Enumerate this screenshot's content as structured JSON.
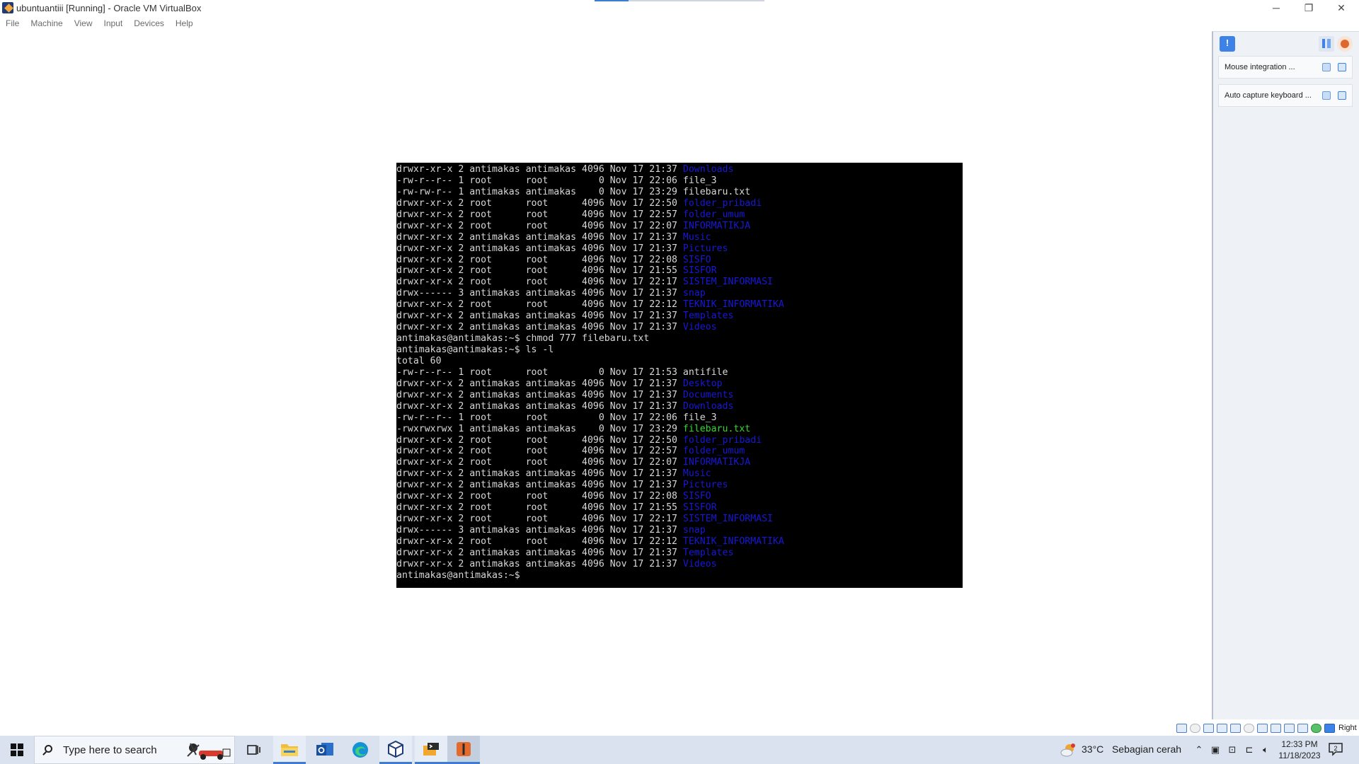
{
  "window": {
    "title": "ubuntuantiii [Running] - Oracle VM VirtualBox",
    "minimize": "─",
    "restore": "❐",
    "close": "✕"
  },
  "menu": [
    "File",
    "Machine",
    "View",
    "Input",
    "Devices",
    "Help"
  ],
  "terminal": {
    "lines": [
      [
        {
          "t": "drwxr-xr-x 2 antimakas antimakas 4096 Nov 17 21:37 ",
          "c": ""
        },
        {
          "t": "Downloads",
          "c": "dir"
        }
      ],
      [
        {
          "t": "-rw-r--r-- 1 root      root         0 Nov 17 22:06 file_3",
          "c": ""
        }
      ],
      [
        {
          "t": "-rw-rw-r-- 1 antimakas antimakas    0 Nov 17 23:29 filebaru.txt",
          "c": ""
        }
      ],
      [
        {
          "t": "drwxr-xr-x 2 root      root      4096 Nov 17 22:50 ",
          "c": ""
        },
        {
          "t": "folder_pribadi",
          "c": "dir"
        }
      ],
      [
        {
          "t": "drwxr-xr-x 2 root      root      4096 Nov 17 22:57 ",
          "c": ""
        },
        {
          "t": "folder_umum",
          "c": "dir"
        }
      ],
      [
        {
          "t": "drwxr-xr-x 2 root      root      4096 Nov 17 22:07 ",
          "c": ""
        },
        {
          "t": "INFORMATIKJA",
          "c": "dir"
        }
      ],
      [
        {
          "t": "drwxr-xr-x 2 antimakas antimakas 4096 Nov 17 21:37 ",
          "c": ""
        },
        {
          "t": "Music",
          "c": "dir"
        }
      ],
      [
        {
          "t": "drwxr-xr-x 2 antimakas antimakas 4096 Nov 17 21:37 ",
          "c": ""
        },
        {
          "t": "Pictures",
          "c": "dir"
        }
      ],
      [
        {
          "t": "drwxr-xr-x 2 root      root      4096 Nov 17 22:08 ",
          "c": ""
        },
        {
          "t": "SISFO",
          "c": "dir"
        }
      ],
      [
        {
          "t": "drwxr-xr-x 2 root      root      4096 Nov 17 21:55 ",
          "c": ""
        },
        {
          "t": "SISFOR",
          "c": "dir"
        }
      ],
      [
        {
          "t": "drwxr-xr-x 2 root      root      4096 Nov 17 22:17 ",
          "c": ""
        },
        {
          "t": "SISTEM_INFORMASI",
          "c": "dir"
        }
      ],
      [
        {
          "t": "drwx------ 3 antimakas antimakas 4096 Nov 17 21:37 ",
          "c": ""
        },
        {
          "t": "snap",
          "c": "dir"
        }
      ],
      [
        {
          "t": "drwxr-xr-x 2 root      root      4096 Nov 17 22:12 ",
          "c": ""
        },
        {
          "t": "TEKNIK_INFORMATIKA",
          "c": "dir"
        }
      ],
      [
        {
          "t": "drwxr-xr-x 2 antimakas antimakas 4096 Nov 17 21:37 ",
          "c": ""
        },
        {
          "t": "Templates",
          "c": "dir"
        }
      ],
      [
        {
          "t": "drwxr-xr-x 2 antimakas antimakas 4096 Nov 17 21:37 ",
          "c": ""
        },
        {
          "t": "Videos",
          "c": "dir"
        }
      ],
      [
        {
          "t": "antimakas@antimakas:~$ chmod 777 filebaru.txt",
          "c": ""
        }
      ],
      [
        {
          "t": "antimakas@antimakas:~$ ls -l",
          "c": ""
        }
      ],
      [
        {
          "t": "total 60",
          "c": ""
        }
      ],
      [
        {
          "t": "-rw-r--r-- 1 root      root         0 Nov 17 21:53 antifile",
          "c": ""
        }
      ],
      [
        {
          "t": "drwxr-xr-x 2 antimakas antimakas 4096 Nov 17 21:37 ",
          "c": ""
        },
        {
          "t": "Desktop",
          "c": "dir"
        }
      ],
      [
        {
          "t": "drwxr-xr-x 2 antimakas antimakas 4096 Nov 17 21:37 ",
          "c": ""
        },
        {
          "t": "Documents",
          "c": "dir"
        }
      ],
      [
        {
          "t": "drwxr-xr-x 2 antimakas antimakas 4096 Nov 17 21:37 ",
          "c": ""
        },
        {
          "t": "Downloads",
          "c": "dir"
        }
      ],
      [
        {
          "t": "-rw-r--r-- 1 root      root         0 Nov 17 22:06 file_3",
          "c": ""
        }
      ],
      [
        {
          "t": "-rwxrwxrwx 1 antimakas antimakas    0 Nov 17 23:29 ",
          "c": ""
        },
        {
          "t": "filebaru.txt",
          "c": "exe"
        }
      ],
      [
        {
          "t": "drwxr-xr-x 2 root      root      4096 Nov 17 22:50 ",
          "c": ""
        },
        {
          "t": "folder_pribadi",
          "c": "dir"
        }
      ],
      [
        {
          "t": "drwxr-xr-x 2 root      root      4096 Nov 17 22:57 ",
          "c": ""
        },
        {
          "t": "folder_umum",
          "c": "dir"
        }
      ],
      [
        {
          "t": "drwxr-xr-x 2 root      root      4096 Nov 17 22:07 ",
          "c": ""
        },
        {
          "t": "INFORMATIKJA",
          "c": "dir"
        }
      ],
      [
        {
          "t": "drwxr-xr-x 2 antimakas antimakas 4096 Nov 17 21:37 ",
          "c": ""
        },
        {
          "t": "Music",
          "c": "dir"
        }
      ],
      [
        {
          "t": "drwxr-xr-x 2 antimakas antimakas 4096 Nov 17 21:37 ",
          "c": ""
        },
        {
          "t": "Pictures",
          "c": "dir"
        }
      ],
      [
        {
          "t": "drwxr-xr-x 2 root      root      4096 Nov 17 22:08 ",
          "c": ""
        },
        {
          "t": "SISFO",
          "c": "dir"
        }
      ],
      [
        {
          "t": "drwxr-xr-x 2 root      root      4096 Nov 17 21:55 ",
          "c": ""
        },
        {
          "t": "SISFOR",
          "c": "dir"
        }
      ],
      [
        {
          "t": "drwxr-xr-x 2 root      root      4096 Nov 17 22:17 ",
          "c": ""
        },
        {
          "t": "SISTEM_INFORMASI",
          "c": "dir"
        }
      ],
      [
        {
          "t": "drwx------ 3 antimakas antimakas 4096 Nov 17 21:37 ",
          "c": ""
        },
        {
          "t": "snap",
          "c": "dir"
        }
      ],
      [
        {
          "t": "drwxr-xr-x 2 root      root      4096 Nov 17 22:12 ",
          "c": ""
        },
        {
          "t": "TEKNIK_INFORMATIKA",
          "c": "dir"
        }
      ],
      [
        {
          "t": "drwxr-xr-x 2 antimakas antimakas 4096 Nov 17 21:37 ",
          "c": ""
        },
        {
          "t": "Templates",
          "c": "dir"
        }
      ],
      [
        {
          "t": "drwxr-xr-x 2 antimakas antimakas 4096 Nov 17 21:37 ",
          "c": ""
        },
        {
          "t": "Videos",
          "c": "dir"
        }
      ],
      [
        {
          "t": "antimakas@antimakas:~$",
          "c": ""
        }
      ]
    ],
    "colors": {
      "text": "#d8d8d8",
      "dir": "#1818d8",
      "exe": "#35d835",
      "background": "#000000"
    }
  },
  "side_panel": {
    "notifications": [
      {
        "label": "Mouse integration ..."
      },
      {
        "label": "Auto capture keyboard ..."
      }
    ]
  },
  "statusbar": {
    "icons": [
      "hard-disk-icon",
      "optical-drive-icon",
      "audio-icon",
      "network-icon",
      "usb-icon",
      "shared-folders-icon",
      "display-icon",
      "video-capture-icon",
      "recording-icon",
      "cpu-icon",
      "green-status-icon",
      "keyboard-arrow-icon"
    ],
    "host_key": "Right Ctrl"
  },
  "taskbar": {
    "search_placeholder": "Type here to search",
    "apps": [
      "task-view-icon",
      "file-explorer-icon",
      "outlook-icon",
      "edge-icon",
      "virtualbox-manager-icon",
      "terminal-app-icon",
      "virtualbox-vm-icon"
    ],
    "weather": {
      "temp": "33°C",
      "condition": "Sebagian cerah"
    },
    "time": "12:33 PM",
    "date": "11/18/2023",
    "notifications_count": "2"
  }
}
